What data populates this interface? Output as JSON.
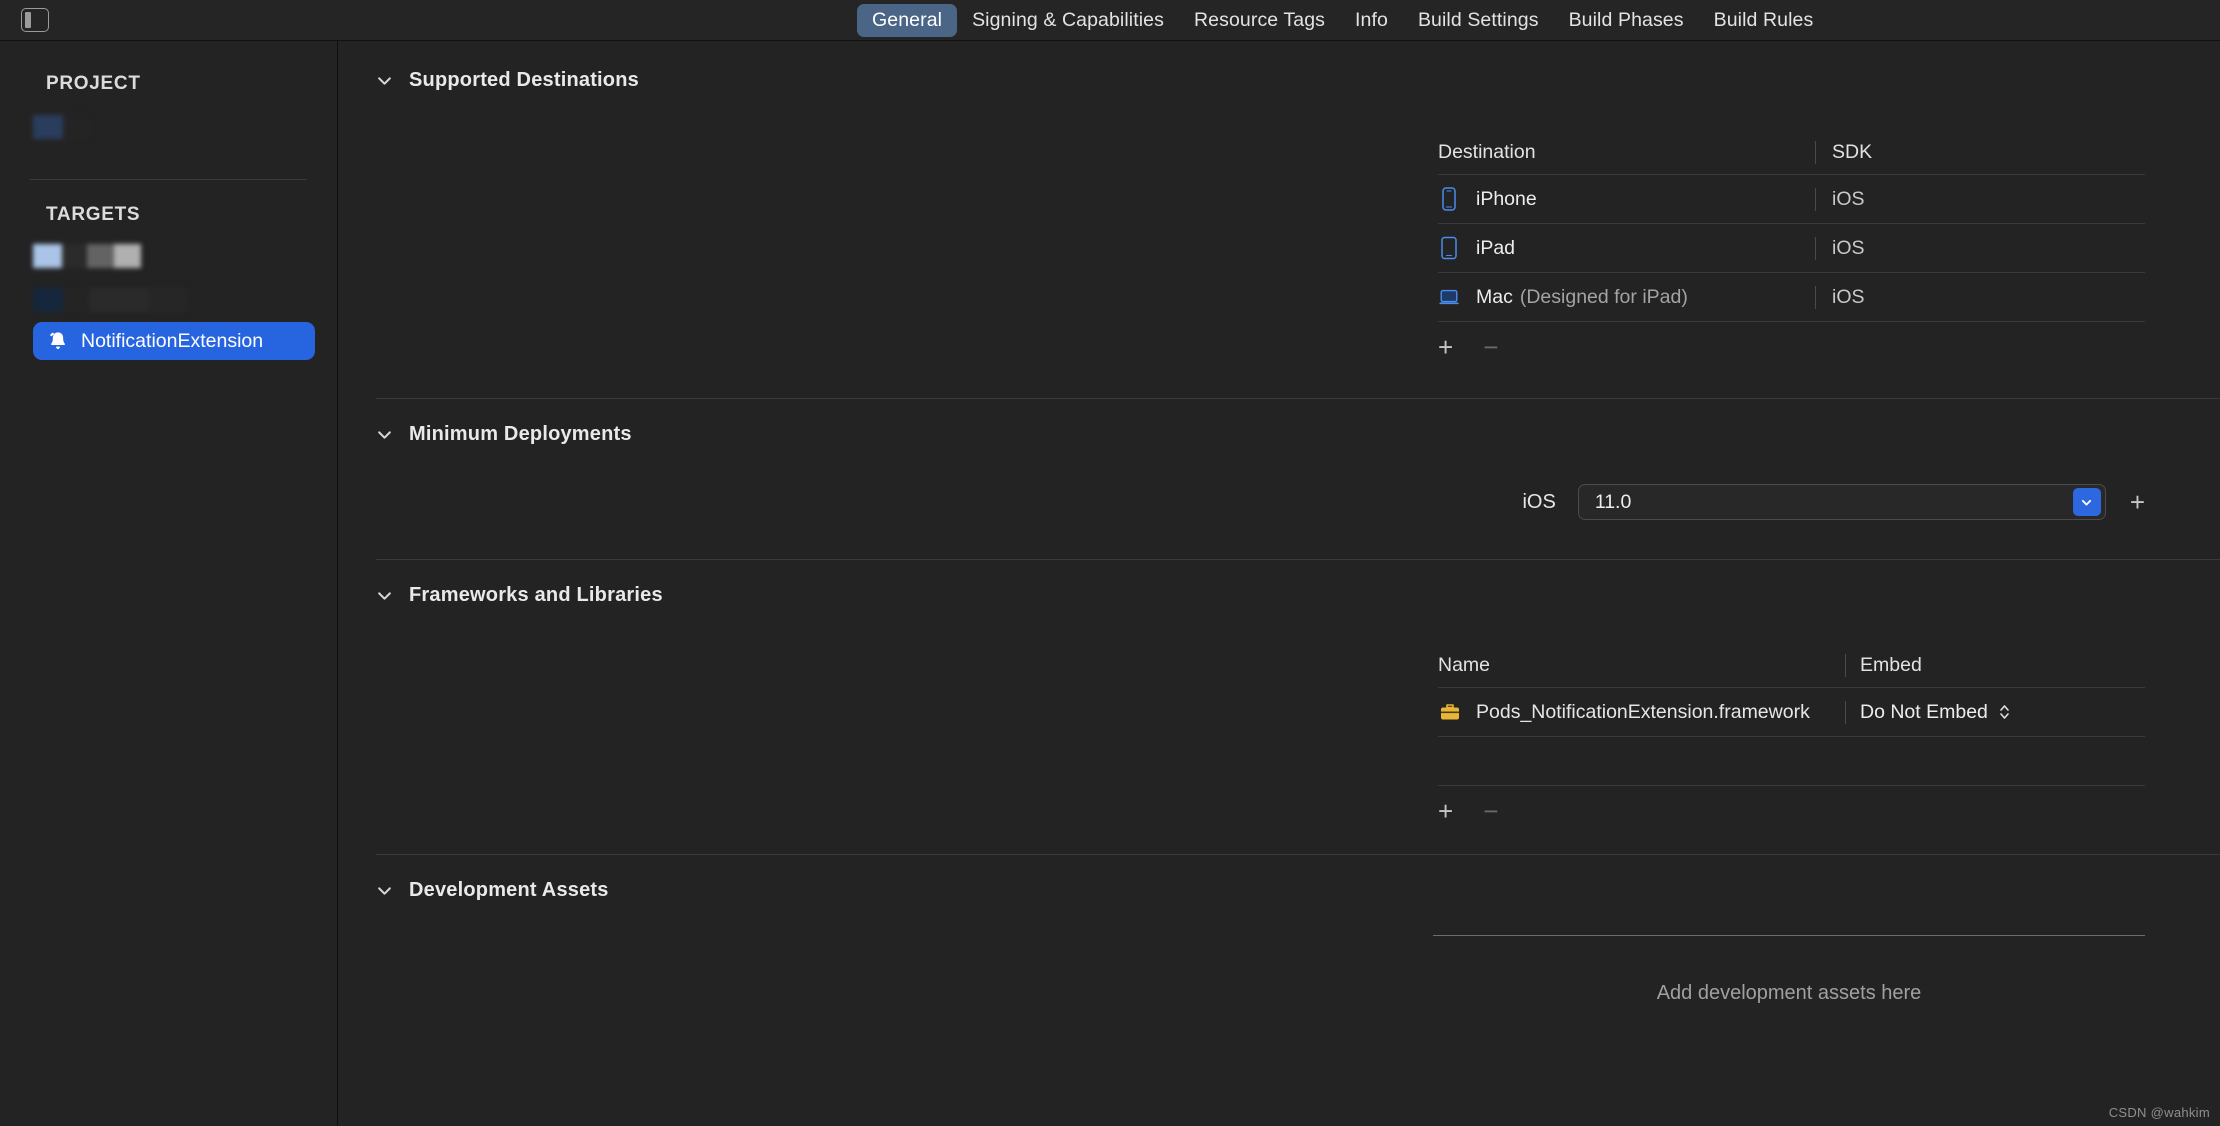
{
  "toolbar": {
    "sidebar_toggle_icon": "sidebar-toggle-icon",
    "tabs": [
      {
        "label": "General",
        "active": true
      },
      {
        "label": "Signing & Capabilities",
        "active": false
      },
      {
        "label": "Resource Tags",
        "active": false
      },
      {
        "label": "Info",
        "active": false
      },
      {
        "label": "Build Settings",
        "active": false
      },
      {
        "label": "Build Phases",
        "active": false
      },
      {
        "label": "Build Rules",
        "active": false
      }
    ]
  },
  "sidebar": {
    "project_heading": "PROJECT",
    "targets_heading": "TARGETS",
    "project_items": [
      {
        "label": "",
        "redacted": true
      }
    ],
    "target_items": [
      {
        "label": "",
        "redacted": true
      },
      {
        "label": "",
        "redacted": true
      },
      {
        "label": "NotificationExtension",
        "redacted": false,
        "selected": true,
        "icon": "bell-icon"
      }
    ]
  },
  "sections": {
    "supported_destinations": {
      "title": "Supported Destinations",
      "chevron_icon": "chevron-down-icon",
      "columns": [
        "Destination",
        "SDK"
      ],
      "rows": [
        {
          "icon": "iphone-icon",
          "name": "iPhone",
          "note": "",
          "sdk": "iOS"
        },
        {
          "icon": "ipad-icon",
          "name": "iPad",
          "note": "",
          "sdk": "iOS"
        },
        {
          "icon": "mac-icon",
          "name": "Mac",
          "note": "(Designed for iPad)",
          "sdk": "iOS"
        }
      ],
      "add_label": "+",
      "remove_label": "−"
    },
    "minimum_deployments": {
      "title": "Minimum Deployments",
      "chevron_icon": "chevron-down-icon",
      "platform_label": "iOS",
      "version_value": "11.0",
      "dropdown_icon": "chevron-down-icon",
      "add_label": "+"
    },
    "frameworks_and_libraries": {
      "title": "Frameworks and Libraries",
      "chevron_icon": "chevron-down-icon",
      "columns": [
        "Name",
        "Embed"
      ],
      "rows": [
        {
          "icon": "framework-icon",
          "name": "Pods_NotificationExtension.framework",
          "embed": "Do Not Embed",
          "embed_icon": "chevron-up-down-icon"
        }
      ],
      "add_label": "+",
      "remove_label": "−"
    },
    "development_assets": {
      "title": "Development Assets",
      "chevron_icon": "chevron-down-icon",
      "empty_text": "Add development assets here"
    }
  },
  "watermark": "CSDN @wahkim",
  "colors": {
    "background": "#232323",
    "toolbar": "#252525",
    "accent_blue": "#2765e0",
    "tab_active": "#4a6585",
    "device_icon_blue": "#4a8df0",
    "framework_yellow": "#e8b637",
    "separator": "#3a3a3a"
  }
}
